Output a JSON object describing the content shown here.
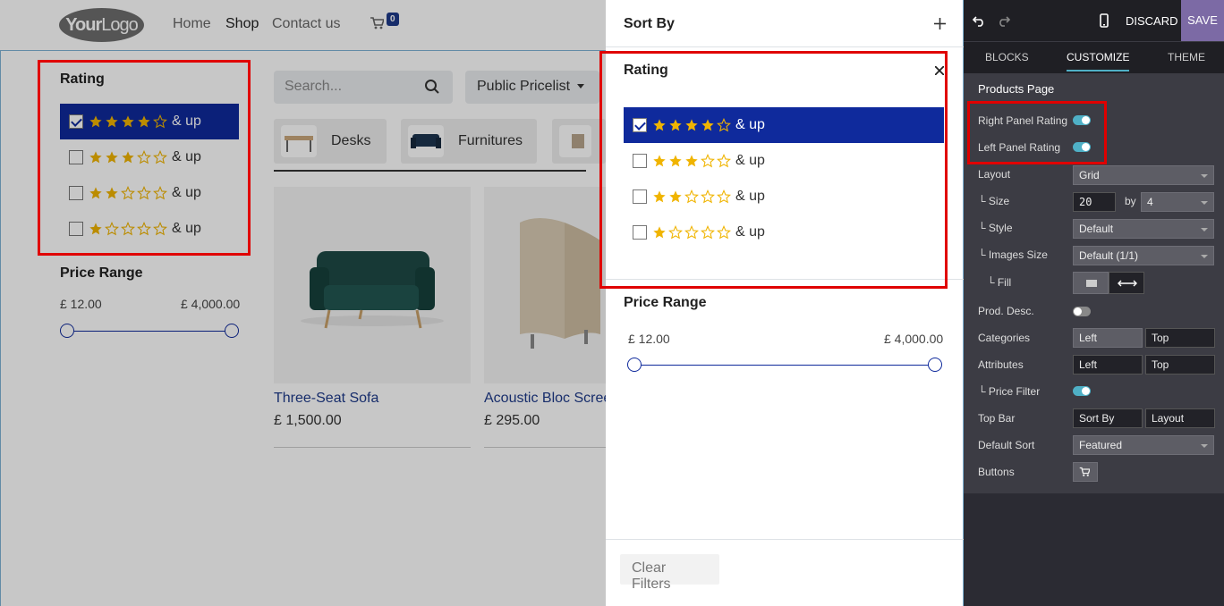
{
  "site": {
    "logo": {
      "bold": "Your",
      "thin": "Logo"
    },
    "nav": {
      "home": "Home",
      "shop": "Shop",
      "contact": "Contact us",
      "cart_count": "0"
    },
    "rating": {
      "title": "Rating",
      "options": [
        {
          "stars": 4,
          "label": "& up",
          "checked": true
        },
        {
          "stars": 3,
          "label": "& up",
          "checked": false
        },
        {
          "stars": 2,
          "label": "& up",
          "checked": false
        },
        {
          "stars": 1,
          "label": "& up",
          "checked": false
        }
      ]
    },
    "price_range": {
      "title": "Price Range",
      "min": "£ 12.00",
      "max": "£ 4,000.00"
    },
    "search_placeholder": "Search...",
    "pricelist": "Public Pricelist",
    "categories": [
      "Desks",
      "Furnitures"
    ],
    "products": [
      {
        "name": "Three-Seat Sofa",
        "price": "£ 1,500.00"
      },
      {
        "name": "Acoustic Bloc Screens",
        "price": "£ 295.00"
      }
    ]
  },
  "panel": {
    "sort_by": "Sort By",
    "rating_title": "Rating",
    "rating_options": [
      {
        "stars": 4,
        "label": "& up",
        "checked": true
      },
      {
        "stars": 3,
        "label": "& up",
        "checked": false
      },
      {
        "stars": 2,
        "label": "& up",
        "checked": false
      },
      {
        "stars": 1,
        "label": "& up",
        "checked": false
      }
    ],
    "price_title": "Price Range",
    "price_min": "£ 12.00",
    "price_max": "£ 4,000.00",
    "clear_filters": "Clear Filters"
  },
  "editor": {
    "discard": "DISCARD",
    "save": "SAVE",
    "tabs": {
      "blocks": "BLOCKS",
      "customize": "CUSTOMIZE",
      "theme": "THEME"
    },
    "section_title": "Products Page",
    "right_panel_rating": "Right Panel Rating",
    "left_panel_rating": "Left Panel Rating",
    "layout": {
      "label": "Layout",
      "value": "Grid"
    },
    "size": {
      "label": "Size",
      "value": "20",
      "by": "by",
      "cols": "4"
    },
    "style": {
      "label": "Style",
      "value": "Default"
    },
    "images_size": {
      "label": "Images Size",
      "value": "Default (1/1)"
    },
    "fill": {
      "label": "Fill"
    },
    "prod_desc": {
      "label": "Prod. Desc."
    },
    "categories": {
      "label": "Categories",
      "opt1": "Left",
      "opt2": "Top"
    },
    "attributes": {
      "label": "Attributes",
      "opt1": "Left",
      "opt2": "Top"
    },
    "price_filter": {
      "label": "Price Filter"
    },
    "top_bar": {
      "label": "Top Bar",
      "opt1": "Sort By",
      "opt2": "Layout"
    },
    "default_sort": {
      "label": "Default Sort",
      "value": "Featured"
    },
    "buttons": {
      "label": "Buttons"
    },
    "accent_color": "#4fb0c6",
    "save_color": "#7c6aa5"
  },
  "colors": {
    "primary": "#0f2a9c",
    "star": "#f0b400",
    "highlight": "#e00000"
  }
}
